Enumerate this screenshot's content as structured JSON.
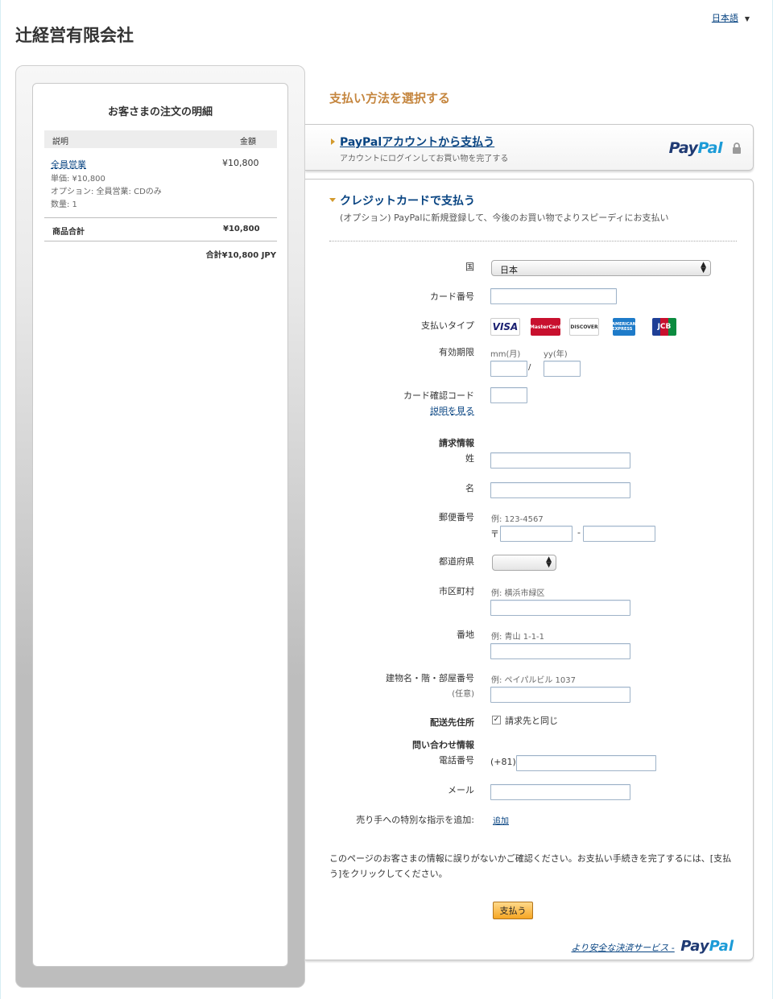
{
  "header": {
    "language": "日本語",
    "merchant_name": "辻経営有限会社"
  },
  "order": {
    "title": "お客さまの注文の明細",
    "col_description": "説明",
    "col_amount": "金額",
    "item": {
      "name": "全員営業",
      "amount": "¥10,800",
      "unit_price": "単価: ¥10,800",
      "option": "オプション: 全員営業: CDのみ",
      "quantity": "数量: 1"
    },
    "subtotal_label": "商品合計",
    "subtotal_value": "¥10,800",
    "total": "合計¥10,800 JPY"
  },
  "payment": {
    "section_title": "支払い方法を選択する",
    "paypal_option": {
      "title": "PayPalアカウントから支払う",
      "subtitle": "アカウントにログインしてお買い物を完了する",
      "logo_pay": "Pay",
      "logo_pal": "Pal"
    },
    "card_option": {
      "title": "クレジットカードで支払う",
      "subtitle": "(オプション) PayPalに新規登録して、今後のお買い物でよりスピーディにお支払い"
    }
  },
  "form": {
    "country_label": "国",
    "country_value": "日本",
    "card_number_label": "カード番号",
    "card_type_label": "支払いタイプ",
    "card_types": [
      "VISA",
      "MasterCard",
      "DISCOVER",
      "AMERICAN EXPRESS",
      "JCB"
    ],
    "expiry_label": "有効期限",
    "expiry_month_hint": "mm(月)",
    "expiry_year_hint": "yy(年)",
    "expiry_sep": "/",
    "cvv_label": "カード確認コード",
    "cvv_help_link": "説明を見る",
    "billing_heading": "請求情報",
    "last_name_label": "姓",
    "first_name_label": "名",
    "postal_label": "郵便番号",
    "postal_hint": "例: 123-4567",
    "postal_mark": "〒",
    "postal_sep": "-",
    "prefecture_label": "都道府県",
    "city_label": "市区町村",
    "city_hint": "例: 横浜市緑区",
    "street_label": "番地",
    "street_hint": "例: 青山 1-1-1",
    "building_label": "建物名・階・部屋番号",
    "building_optional": "(任意)",
    "building_hint": "例: ペイパルビル 1037",
    "shipping_label": "配送先住所",
    "shipping_same": "請求先と同じ",
    "shipping_checked": "✓",
    "contact_heading": "問い合わせ情報",
    "phone_label": "電話番号",
    "phone_prefix": "(+81)",
    "email_label": "メール",
    "instructions_label": "売り手への特別な指示を追加:",
    "instructions_link": "追加",
    "confirm_text": "このページのお客さまの情報に誤りがないかご確認ください。お支払い手続きを完了するには、[支払う]をクリックしてください。",
    "pay_button": "支払う",
    "secure_text": "より安全な決済サービス -"
  },
  "colors": {
    "link": "#084482",
    "section_title": "#c5863f",
    "pay_button": "#f6a623",
    "paypal_dark": "#1f3a73",
    "paypal_light": "#1c9bd7"
  }
}
